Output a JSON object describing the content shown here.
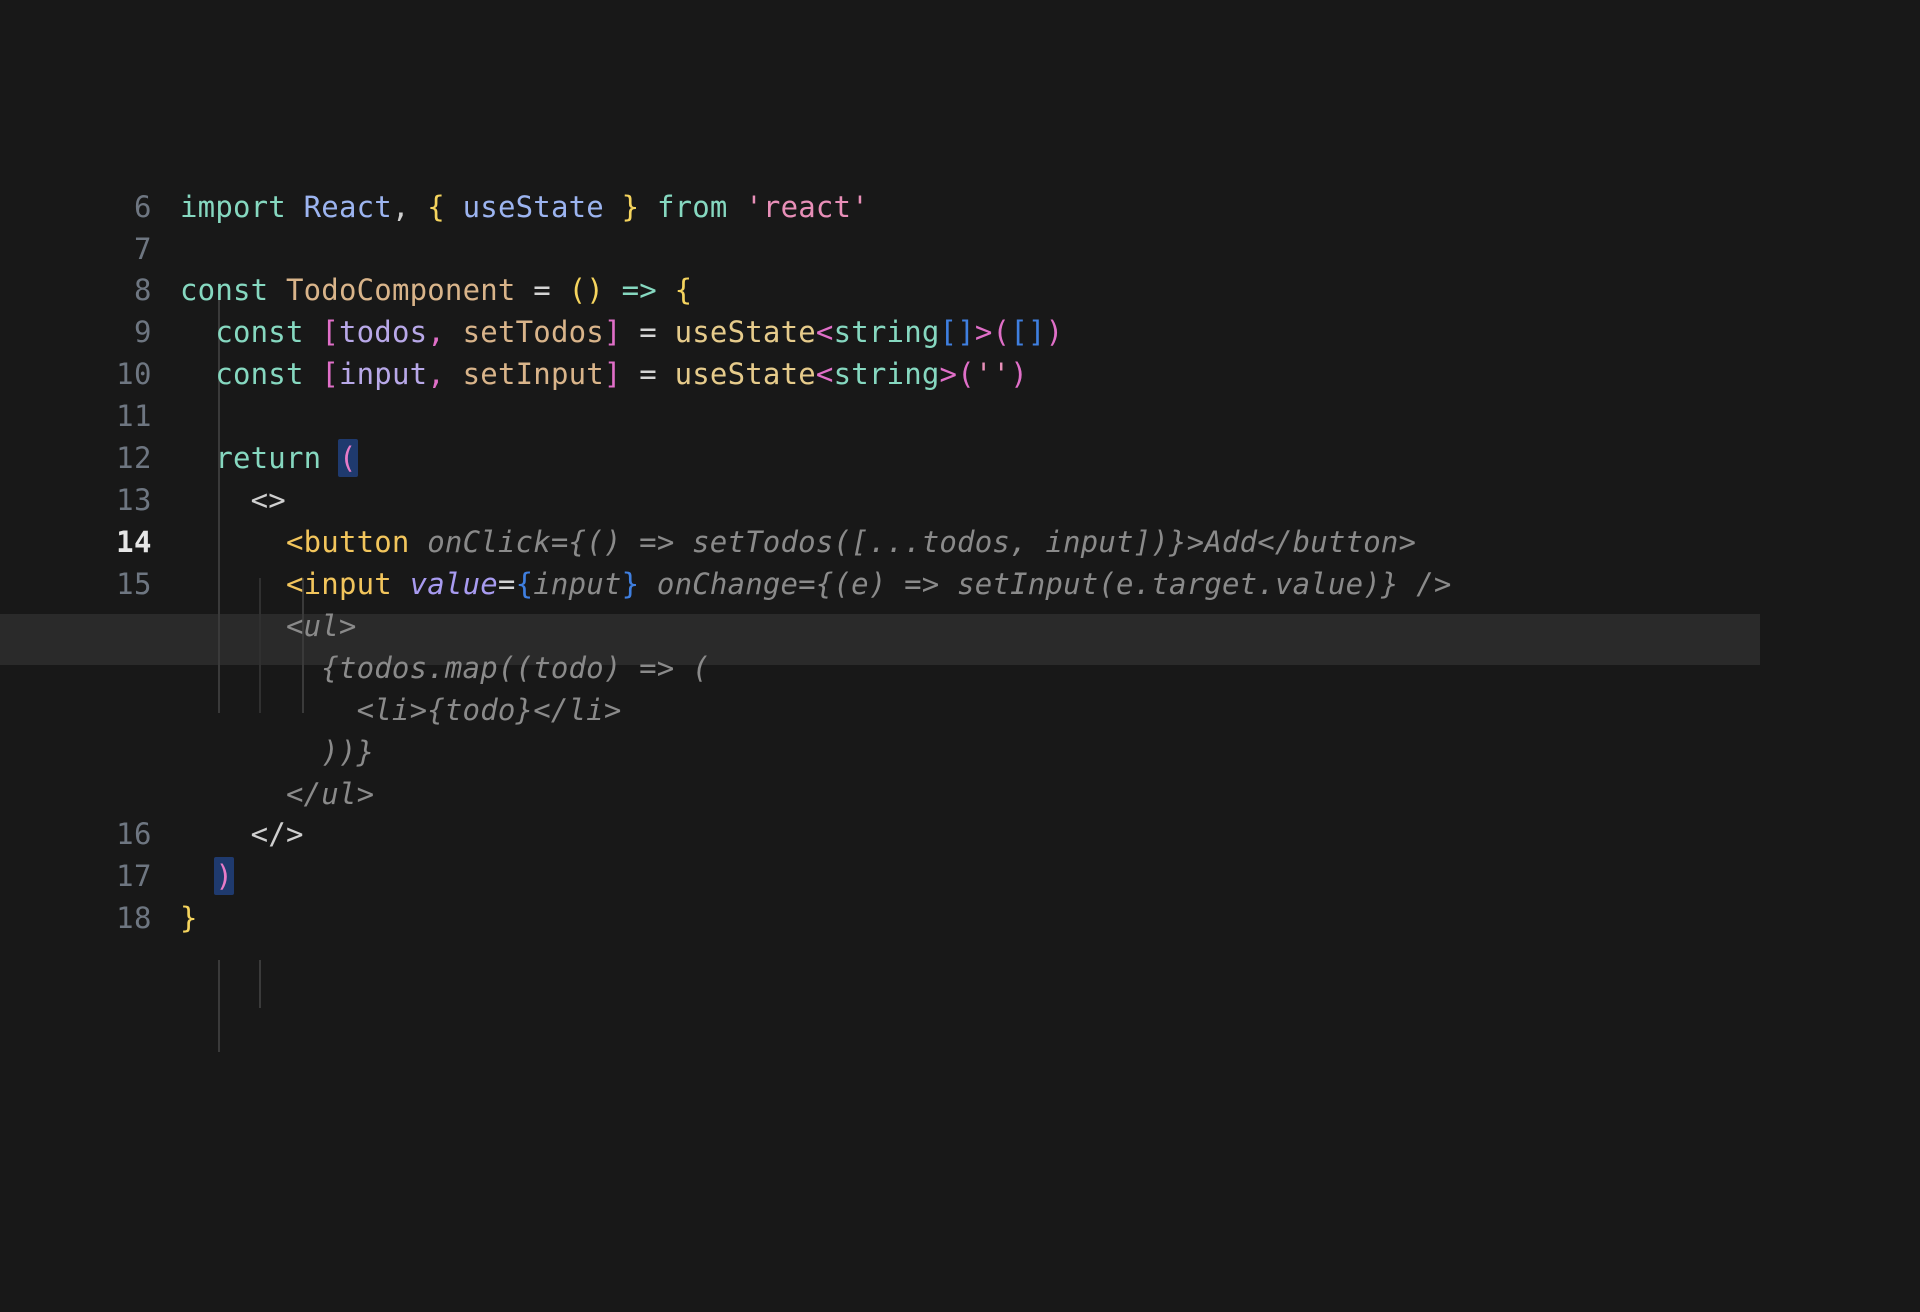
{
  "editor": {
    "background_color": "#181818",
    "active_line_color": "#2a2a2a",
    "gutter_color": "#6e7681",
    "active_gutter_color": "#e6e6e6",
    "ghost_text_color": "#8a8a8a",
    "bracket_match_color": "#1f3a6e",
    "active_line_number": "14"
  },
  "line_numbers": {
    "n6": "6",
    "n7": "7",
    "n8": "8",
    "n9": "9",
    "n10": "10",
    "n11": "11",
    "n12": "12",
    "n13": "13",
    "n14": "14",
    "n15": "15",
    "n16": "16",
    "n17": "17",
    "n18": "18"
  },
  "code": {
    "l6": {
      "import_kw": "import",
      "sp1": " ",
      "react_ident": "React",
      "comma": ",",
      "sp2": " ",
      "brace_open": "{",
      "sp3": " ",
      "usestate_ident": "useState",
      "sp4": " ",
      "brace_close": "}",
      "sp5": " ",
      "from_kw": "from",
      "sp6": " ",
      "module_str": "'react'"
    },
    "l8": {
      "const_kw": "const",
      "sp1": " ",
      "component_name": "TodoComponent",
      "sp2": " ",
      "equals": "=",
      "sp3": " ",
      "paren_open": "(",
      "paren_close": ")",
      "sp4": " ",
      "arrow": "=>",
      "sp5": " ",
      "brace_open": "{"
    },
    "l9": {
      "indent": "  ",
      "const_kw": "const",
      "sp1": " ",
      "bracket_open": "[",
      "state_var": "todos",
      "comma": ",",
      "sp2": " ",
      "setter_fn": "setTodos",
      "bracket_close": "]",
      "sp3": " ",
      "equals": "=",
      "sp4": " ",
      "hook": "useState",
      "generic_open": "<",
      "generic_type": "string",
      "generic_arr_open": "[",
      "generic_arr_close": "]",
      "generic_close": ">",
      "call_open": "(",
      "arg_open": "[",
      "arg_close": "]",
      "call_close": ")"
    },
    "l10": {
      "indent": "  ",
      "const_kw": "const",
      "sp1": " ",
      "bracket_open": "[",
      "state_var": "input",
      "comma": ",",
      "sp2": " ",
      "setter_fn": "setInput",
      "bracket_close": "]",
      "sp3": " ",
      "equals": "=",
      "sp4": " ",
      "hook": "useState",
      "generic_open": "<",
      "generic_type": "string",
      "generic_close": ">",
      "call_open": "(",
      "empty_str": "''",
      "call_close": ")"
    },
    "l12": {
      "indent": "  ",
      "return_kw": "return",
      "sp1": " ",
      "paren_open": "("
    },
    "l13": {
      "indent": "    ",
      "fragment_open": "<>"
    },
    "l14": {
      "indent": "      ",
      "tag_open": "<button",
      "suggestion": " onClick={() => setTodos([...todos, input])}>Add</button>"
    },
    "l15": {
      "indent": "      ",
      "tag_open": "<input",
      "sp1": " ",
      "attr_name": "value",
      "equals": "=",
      "brace_open": "{",
      "attr_value": "input",
      "brace_close": "}",
      "suggestion": " onChange={(e) => setInput(e.target.value)} />"
    },
    "ghost_lines": [
      {
        "text": "      <ul>"
      },
      {
        "text": "        {todos.map((todo) => ("
      },
      {
        "text": "          <li>{todo}</li>"
      },
      {
        "text": "        ))}"
      },
      {
        "text": "      </ul>"
      }
    ],
    "l16": {
      "indent": "    ",
      "fragment_close": "</>"
    },
    "l17": {
      "indent": "  ",
      "paren_close": ")"
    },
    "l18": {
      "brace_close": "}"
    }
  }
}
